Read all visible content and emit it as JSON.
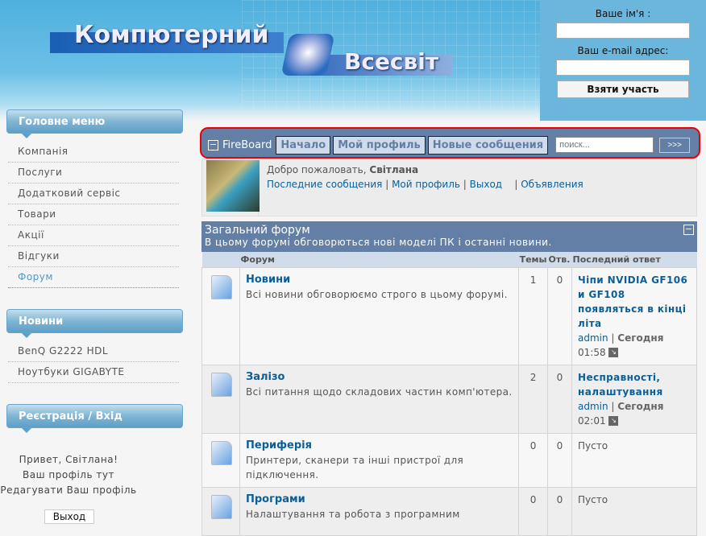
{
  "header": {
    "logo_line1": "Компютерний",
    "logo_line2": "Всесвіт"
  },
  "registration": {
    "name_label": "Ваше ім'я :",
    "email_label": "Ваш e-mail адрес:",
    "submit": "Взяти участь"
  },
  "sidebar": {
    "main_menu_title": "Головне меню",
    "main_menu": [
      "Компанія",
      "Послуги",
      "Додатковий сервіс",
      "Товари",
      "Акції",
      "Відгуки",
      "Форум"
    ],
    "news_title": "Новини",
    "news": [
      "BenQ G2222 HDL",
      "Ноутбуки GIGABYTE"
    ],
    "login_title": "Реєстрація / Вхід",
    "greeting": "Привет, Світлана!",
    "profile_here": "Ваш профіль тут",
    "edit_profile": "Редагувати Ваш профіль",
    "logout": "Выход"
  },
  "toolbar": {
    "collapse": "−",
    "brand": "FireBoard",
    "nav": [
      "Начало",
      "Мой профиль",
      "Новые сообщения"
    ],
    "search_placeholder": "поиск...",
    "search_button": ">>>"
  },
  "welcome": {
    "prefix": "Добро пожаловать,",
    "user": "Світлана",
    "links": [
      "Последние сообщения",
      "Мой профиль",
      "Выход",
      "Объявления"
    ]
  },
  "forum": {
    "title": "Загальний форум",
    "description": "В цьому форумі обговорються нові моделі ПК і останні новини.",
    "collapse": "−",
    "columns": [
      "Форум",
      "Темы",
      "Отв.",
      "Последний ответ"
    ],
    "rows": [
      {
        "name": "Новини",
        "desc": "Всі новини обговорюємо строго в цьому форумі.",
        "topics": "1",
        "replies": "0",
        "last_title": "Чіпи NVIDIA GF106 и GF108 появляться в кінці літа",
        "last_user": "admin",
        "last_day": "Сегодня",
        "last_time": "01:58"
      },
      {
        "name": "Залізо",
        "desc": "Всі питання щодо складових частин комп'ютера.",
        "topics": "2",
        "replies": "0",
        "last_title": "Несправності, налаштування",
        "last_user": "admin",
        "last_day": "Сегодня",
        "last_time": "02:01"
      },
      {
        "name": "Периферія",
        "desc": "Принтери, сканери та інші пристрої для підключення.",
        "topics": "0",
        "replies": "0",
        "empty": "Пусто"
      },
      {
        "name": "Програми",
        "desc": "Налаштування та робота з програмним",
        "topics": "0",
        "replies": "0",
        "empty": "Пусто"
      }
    ]
  }
}
